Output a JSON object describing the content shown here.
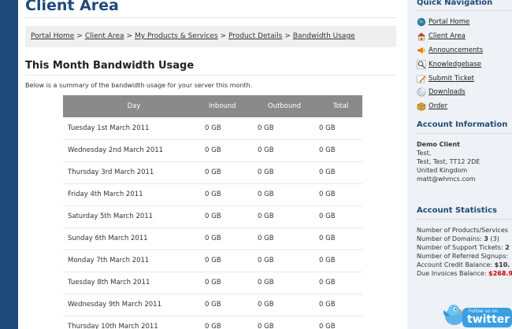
{
  "page": {
    "title": "Client Area",
    "breadcrumb": [
      "Portal Home",
      "Client Area",
      "My Products & Services",
      "Product Details",
      "Bandwidth Usage"
    ],
    "breadcrumb_sep": ">"
  },
  "usage": {
    "heading": "This Month Bandwidth Usage",
    "intro": "Below is a summary of the bandwidth usage for your server this month.",
    "columns": [
      "Day",
      "Inbound",
      "Outbound",
      "Total"
    ],
    "rows": [
      [
        "Tuesday 1st March 2011",
        "0 GB",
        "0 GB",
        "0 GB"
      ],
      [
        "Wednesday 2nd March 2011",
        "0 GB",
        "0 GB",
        "0 GB"
      ],
      [
        "Thursday 3rd March 2011",
        "0 GB",
        "0 GB",
        "0 GB"
      ],
      [
        "Friday 4th March 2011",
        "0 GB",
        "0 GB",
        "0 GB"
      ],
      [
        "Saturday 5th March 2011",
        "0 GB",
        "0 GB",
        "0 GB"
      ],
      [
        "Sunday 6th March 2011",
        "0 GB",
        "0 GB",
        "0 GB"
      ],
      [
        "Monday 7th March 2011",
        "0 GB",
        "0 GB",
        "0 GB"
      ],
      [
        "Tuesday 8th March 2011",
        "0 GB",
        "0 GB",
        "0 GB"
      ],
      [
        "Wednesday 9th March 2011",
        "0 GB",
        "0 GB",
        "0 GB"
      ],
      [
        "Thursday 10th March 2011",
        "0 GB",
        "0 GB",
        "0 GB"
      ]
    ]
  },
  "sidebar": {
    "nav_heading": "Quick Navigation",
    "nav_items": [
      {
        "label": "Portal Home",
        "icon": "globe-icon"
      },
      {
        "label": "Client Area",
        "icon": "home-icon"
      },
      {
        "label": "Announcements",
        "icon": "megaphone-icon"
      },
      {
        "label": "Knowledgebase",
        "icon": "magnifier-icon"
      },
      {
        "label": "Submit Ticket",
        "icon": "pencil-icon"
      },
      {
        "label": "Downloads",
        "icon": "disc-icon"
      },
      {
        "label": "Order",
        "icon": "box-icon"
      }
    ],
    "account_heading": "Account Information",
    "account": {
      "name": "Demo Client",
      "lines": [
        "Test,",
        "Test, Test, TT12 2DE",
        "United Kingdom",
        "matt@whmcs.com"
      ]
    },
    "stats_heading": "Account Statistics",
    "stats": {
      "products_label": "Number of Products/Services",
      "domains_label": "Number of Domains:",
      "domains_value": "3",
      "domains_extra": "(3)",
      "tickets_label": "Number of Support Tickets:",
      "tickets_value": "2",
      "referred_label": "Number of Referred Signups:",
      "credit_label": "Account Credit Balance:",
      "credit_value": "$10.",
      "invoices_label": "Due Invoices Balance:",
      "invoices_value": "$268.9"
    },
    "twitter": {
      "small": "Follow us on",
      "big": "twitter"
    }
  },
  "colors": {
    "brand": "#1f4a7a",
    "table_header": "#8a8a8a",
    "money": "#cc0000"
  }
}
